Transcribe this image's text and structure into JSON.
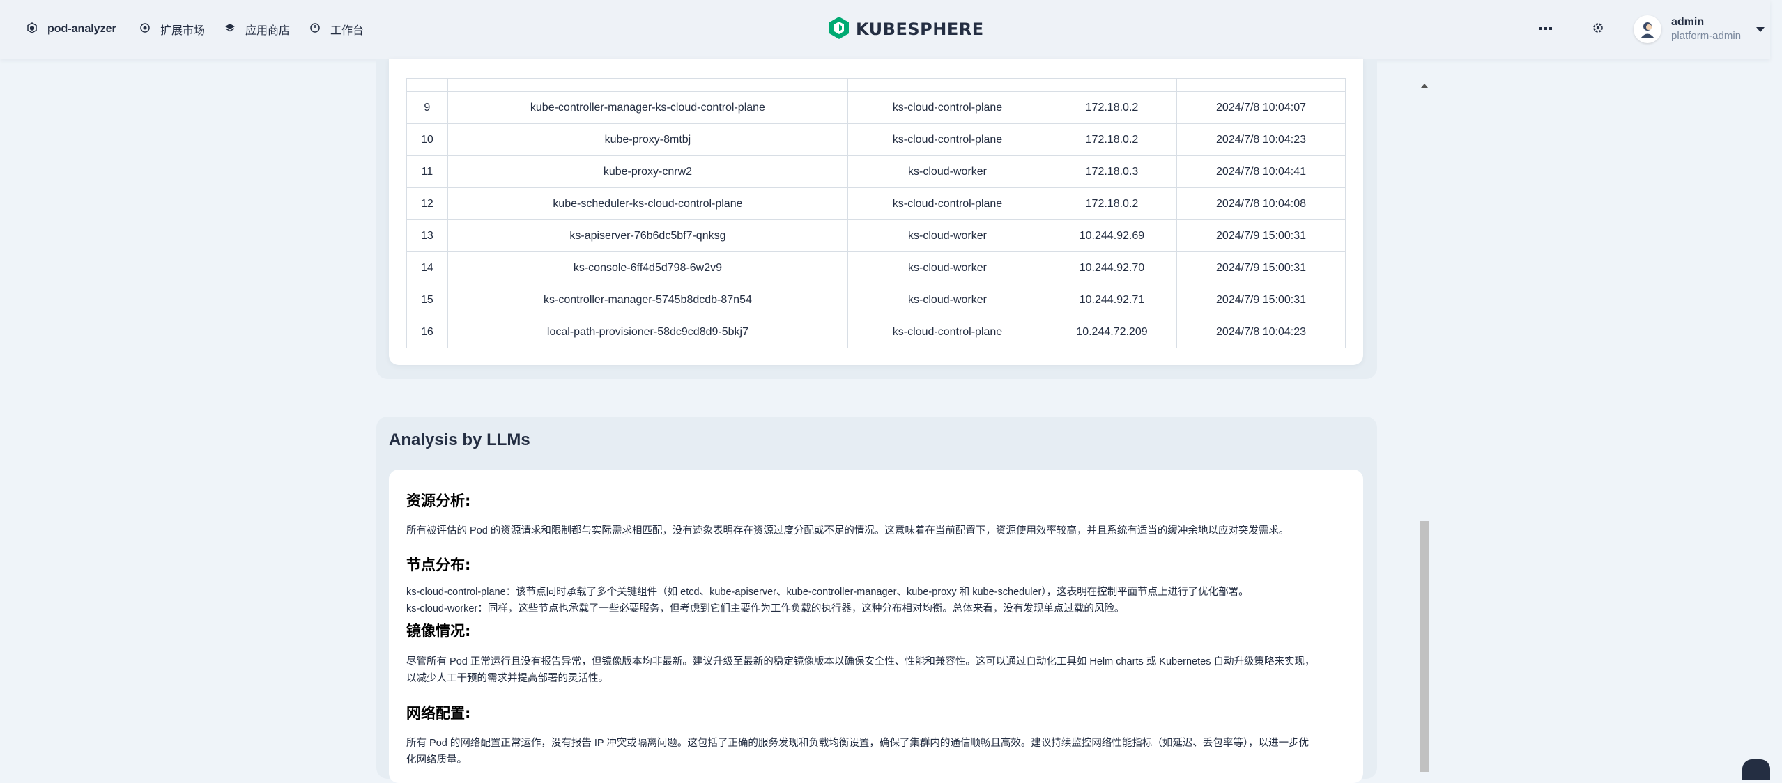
{
  "nav": {
    "items": [
      {
        "label": "pod-analyzer",
        "icon": "cube-icon"
      },
      {
        "label": "扩展市场",
        "icon": "extension-icon"
      },
      {
        "label": "应用商店",
        "icon": "layers-icon"
      },
      {
        "label": "工作台",
        "icon": "dashboard-icon"
      }
    ],
    "logo_text": "KUBESPHERE",
    "user": {
      "name": "admin",
      "role": "platform-admin"
    }
  },
  "colors": {
    "brand": "#00aa72",
    "text": "#242e42",
    "background": "#eff4f9"
  },
  "pods_table": {
    "rows": [
      {
        "no": "9",
        "name": "kube-controller-manager-ks-cloud-control-plane",
        "node": "ks-cloud-control-plane",
        "ip": "172.18.0.2",
        "time": "2024/7/8 10:04:07"
      },
      {
        "no": "10",
        "name": "kube-proxy-8mtbj",
        "node": "ks-cloud-control-plane",
        "ip": "172.18.0.2",
        "time": "2024/7/8 10:04:23"
      },
      {
        "no": "11",
        "name": "kube-proxy-cnrw2",
        "node": "ks-cloud-worker",
        "ip": "172.18.0.3",
        "time": "2024/7/8 10:04:41"
      },
      {
        "no": "12",
        "name": "kube-scheduler-ks-cloud-control-plane",
        "node": "ks-cloud-control-plane",
        "ip": "172.18.0.2",
        "time": "2024/7/8 10:04:08"
      },
      {
        "no": "13",
        "name": "ks-apiserver-76b6dc5bf7-qnksg",
        "node": "ks-cloud-worker",
        "ip": "10.244.92.69",
        "time": "2024/7/9 15:00:31"
      },
      {
        "no": "14",
        "name": "ks-console-6ff4d5d798-6w2v9",
        "node": "ks-cloud-worker",
        "ip": "10.244.92.70",
        "time": "2024/7/9 15:00:31"
      },
      {
        "no": "15",
        "name": "ks-controller-manager-5745b8dcdb-87n54",
        "node": "ks-cloud-worker",
        "ip": "10.244.92.71",
        "time": "2024/7/9 15:00:31"
      },
      {
        "no": "16",
        "name": "local-path-provisioner-58dc9cd8d9-5bkj7",
        "node": "ks-cloud-control-plane",
        "ip": "10.244.72.209",
        "time": "2024/7/8 10:04:23"
      }
    ]
  },
  "analysis": {
    "title": "Analysis by LLMs",
    "sections": [
      {
        "heading": "资源分析:",
        "lines": [
          "所有被评估的 Pod 的资源请求和限制都与实际需求相匹配，没有迹象表明存在资源过度分配或不足的情况。这意味着在当前配置下，资源使用效率较高，并且系统有适当的缓冲余地以应对突发需求。"
        ]
      },
      {
        "heading": "节点分布:",
        "lines": [
          "ks-cloud-control-plane：该节点同时承载了多个关键组件（如 etcd、kube-apiserver、kube-controller-manager、kube-proxy 和 kube-scheduler），这表明在控制平面节点上进行了优化部署。",
          "ks-cloud-worker：同样，这些节点也承载了一些必要服务，但考虑到它们主要作为工作负载的执行器，这种分布相对均衡。总体来看，没有发现单点过载的风险。"
        ]
      },
      {
        "heading": "镜像情况:",
        "lines": [
          "尽管所有 Pod 正常运行且没有报告异常，但镜像版本均非最新。建议升级至最新的稳定镜像版本以确保安全性、性能和兼容性。这可以通过自动化工具如 Helm charts 或 Kubernetes 自动升级策略来实现，",
          "以减少人工干预的需求并提高部署的灵活性。"
        ]
      },
      {
        "heading": "网络配置:",
        "lines": [
          "所有 Pod 的网络配置正常运作，没有报告 IP 冲突或隔离问题。这包括了正确的服务发现和负载均衡设置，确保了集群内的通信顺畅且高效。建议持续监控网络性能指标（如延迟、丢包率等），以进一步优",
          "化网络质量。"
        ]
      }
    ]
  }
}
